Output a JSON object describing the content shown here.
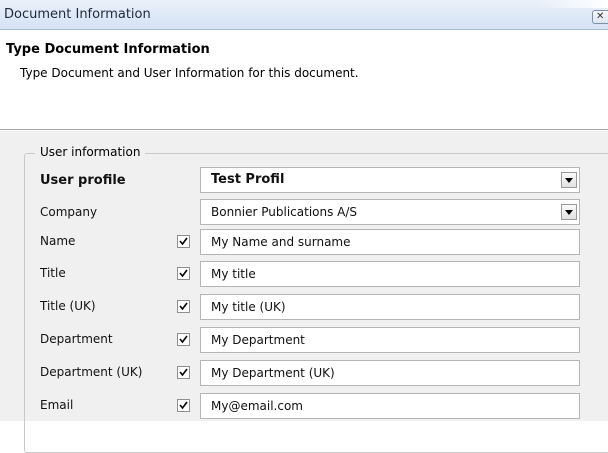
{
  "window": {
    "title": "Document Information",
    "close_glyph": "✕"
  },
  "header": {
    "title": "Type Document Information",
    "description": "Type Document and User Information for this document."
  },
  "user_info": {
    "legend": "User information",
    "user_profile": {
      "label": "User profile",
      "value": "Test Profil"
    },
    "company": {
      "label": "Company",
      "value": "Bonnier Publications A/S"
    },
    "fields": [
      {
        "label": "Name",
        "value": "My Name and surname",
        "checked": true
      },
      {
        "label": "Title",
        "value": "My title",
        "checked": true
      },
      {
        "label": "Title (UK)",
        "value": "My title (UK)",
        "checked": true
      },
      {
        "label": "Department",
        "value": "My Department",
        "checked": true
      },
      {
        "label": "Department (UK)",
        "value": "My Department (UK)",
        "checked": true
      },
      {
        "label": "Email",
        "value": "My@email.com",
        "checked": true
      }
    ]
  }
}
